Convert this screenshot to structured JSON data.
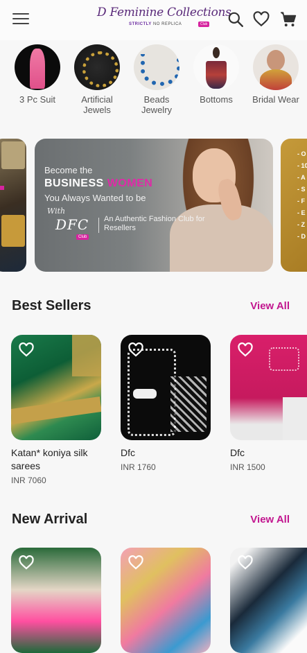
{
  "header": {
    "brand_name": "D Feminine Collections",
    "brand_tagline_prefix": "STRICTLY",
    "brand_tagline": "NO REPLICA",
    "brand_badge": "Club"
  },
  "categories": [
    {
      "label": "3 Pc Suit"
    },
    {
      "label": "Artificial Jewels"
    },
    {
      "label": "Beads Jewelry"
    },
    {
      "label": "Bottoms"
    },
    {
      "label": "Bridal Wear"
    }
  ],
  "banner": {
    "line1": "Become the",
    "line2a": "BUSINESS",
    "line2b": "WOMEN",
    "line3": "You Always Wanted to be",
    "with": "With",
    "dfc": "DFC",
    "club": "Club",
    "tagline": "An Authentic Fashion Club for Resellers",
    "side_right_lines": [
      "- O",
      "- 10",
      "- A",
      "- S",
      "- F",
      "- E",
      "- Z",
      "- D"
    ]
  },
  "best_sellers": {
    "title": "Best Sellers",
    "view_all": "View All",
    "items": [
      {
        "name": "Katan* koniya silk sarees",
        "price": "INR 7060"
      },
      {
        "name": "Dfc",
        "price": "INR 1760"
      },
      {
        "name": "Dfc",
        "price": "INR 1500"
      }
    ]
  },
  "new_arrival": {
    "title": "New Arrival",
    "view_all": "View All"
  },
  "colors": {
    "accent": "#c2168f",
    "brand_purple": "#5a2a7a",
    "background": "#f7f7f7"
  }
}
